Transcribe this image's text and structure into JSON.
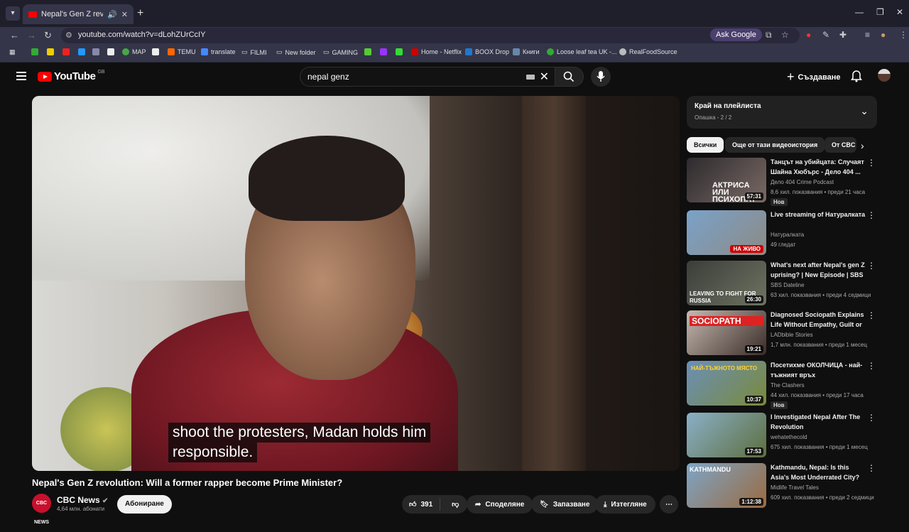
{
  "browser": {
    "tab_title": "Nepal's Gen Z revolution: W",
    "url": "youtube.com/watch?v=dLohZUrCcIY",
    "ask_google": "Ask Google",
    "bookmarks": [
      "MAP",
      "TEMU",
      "translate",
      "FILMI",
      "New folder",
      "GAMING",
      "Home - Netflix",
      "BOOX Drop",
      "Книги",
      "Loose leaf tea UK -...",
      "RealFoodSource"
    ]
  },
  "youtube": {
    "logo": "YouTube",
    "country": "GB",
    "search_query": "nepal genz",
    "create_label": "Създаване"
  },
  "video": {
    "caption_line1": "shoot the protesters, Madan holds him",
    "caption_line2": "responsible.",
    "title": "Nepal's Gen Z revolution: Will a former rapper become Prime Minister?",
    "channel": "CBC News",
    "channel_avatar": "CBC NEWS",
    "subscribers": "4,64 млн. абонати",
    "subscribe_label": "Абониране",
    "likes": "391",
    "share_label": "Споделяне",
    "save_label": "Запазване",
    "download_label": "Изтегляне"
  },
  "queue": {
    "title": "Край на плейлиста",
    "subtitle": "Опашка - 2 / 2"
  },
  "chips": [
    "Всички",
    "Още от тази видеоистория",
    "От CBC"
  ],
  "recommendations": [
    {
      "title": "Танцът на убийцата: Случаят Шайна Хюбърс - Дело 404 ...",
      "channel": "Дело 404 Crime Podcast",
      "meta": "8,6 хил. показвания • преди 21 часа",
      "duration": "57:31",
      "badge": "Нов",
      "overlay": "АКТРИСА ИЛИ ПСИХОПАТ",
      "thumb_colors": [
        "#2d2a2e",
        "#7a6a64"
      ]
    },
    {
      "title": "Live streaming of Натуралката",
      "channel": "Натуралката",
      "meta": "49 гледат",
      "duration": "НА ЖИВО",
      "badge": "",
      "overlay": "",
      "thumb_colors": [
        "#7aa2c9",
        "#8c8a85"
      ]
    },
    {
      "title": "What's next after Nepal's gen Z uprising? | New Episode | SBS ...",
      "channel": "SBS Dateline",
      "meta": "63 хил. показвания • преди 4 седмици",
      "duration": "26:30",
      "badge": "",
      "overlay": "LEAVING TO FIGHT FOR RUSSIA",
      "thumb_colors": [
        "#3c3d3a",
        "#6d7361"
      ]
    },
    {
      "title": "Diagnosed Sociopath Explains Life Without Empathy, Guilt or ...",
      "channel": "LADbible Stories",
      "meta": "1,7 млн. показвания • преди 1 месец",
      "duration": "19:21",
      "badge": "",
      "overlay": "SOCIOPATH",
      "thumb_colors": [
        "#c5b9b0",
        "#3a2c28"
      ]
    },
    {
      "title": "Посетихме ОКОЛЧИЦА - най-тъжният връх",
      "channel": "The Clashers",
      "meta": "44 хил. показвания • преди 17 часа",
      "duration": "10:37",
      "badge": "Нов",
      "overlay": "НАЙ-ТЪЖНОТО МЯСТО",
      "thumb_colors": [
        "#6a8fb8",
        "#7a8a3a"
      ]
    },
    {
      "title": "I Investigated Nepal After The Revolution",
      "channel": "wehatethecold",
      "meta": "675 хил. показвания • преди 1 месец",
      "duration": "17:53",
      "badge": "",
      "overlay": "",
      "thumb_colors": [
        "#8ab0c8",
        "#5d6e3e"
      ]
    },
    {
      "title": "Kathmandu, Nepal: Is this Asia's Most Underrated City?",
      "channel": "Midlife Travel Tales",
      "meta": "609 хил. показвания • преди 2 седмици",
      "duration": "1:12:38",
      "badge": "",
      "overlay": "KATHMANDU",
      "thumb_colors": [
        "#7ea5c6",
        "#9a6a40"
      ]
    }
  ]
}
